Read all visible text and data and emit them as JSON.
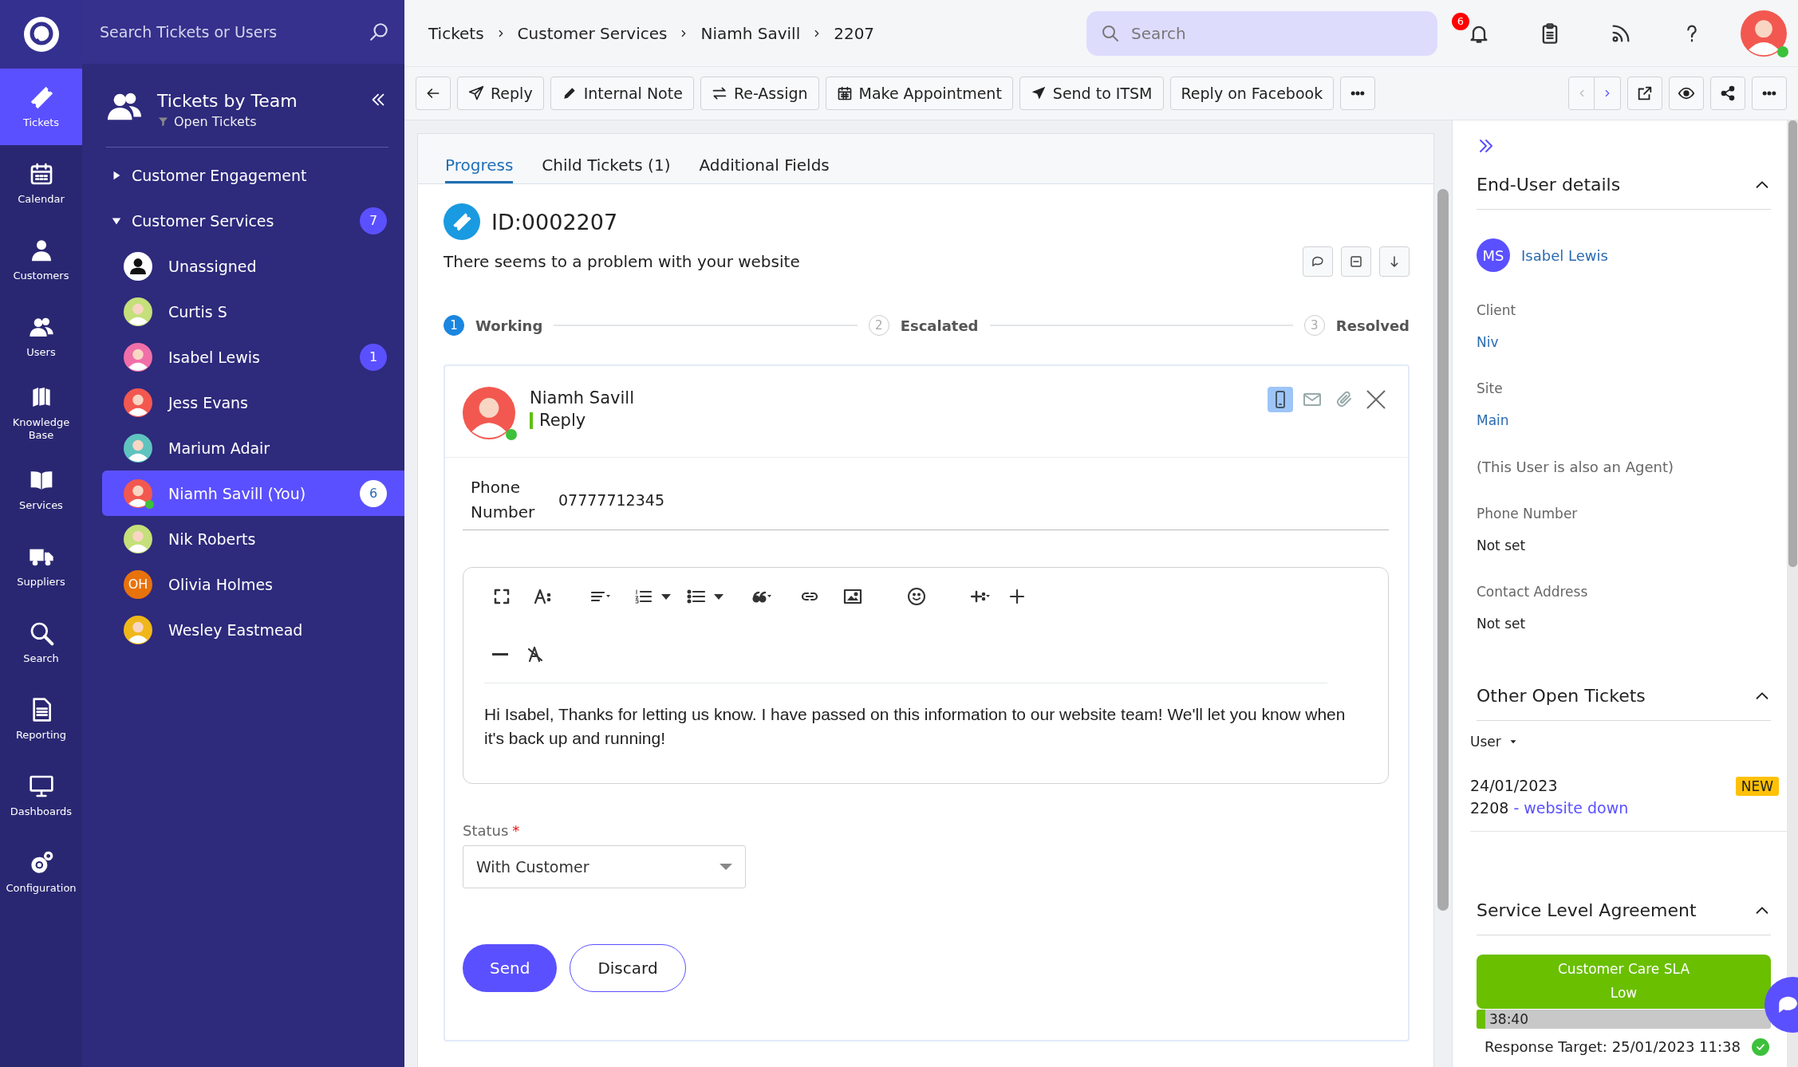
{
  "nav_rail": {
    "items": [
      {
        "label": "Tickets",
        "selected": true
      },
      {
        "label": "Calendar",
        "selected": false
      },
      {
        "label": "Customers",
        "selected": false
      },
      {
        "label": "Users",
        "selected": false
      },
      {
        "label": "Knowledge Base",
        "selected": false
      },
      {
        "label": "Services",
        "selected": false
      },
      {
        "label": "Suppliers",
        "selected": false
      },
      {
        "label": "Search",
        "selected": false
      },
      {
        "label": "Reporting",
        "selected": false
      },
      {
        "label": "Dashboards",
        "selected": false
      },
      {
        "label": "Configuration",
        "selected": false
      }
    ]
  },
  "team_panel": {
    "search": {
      "placeholder": "Search Tickets or Users"
    },
    "title": "Tickets by Team",
    "filter": "Open Tickets",
    "groups": [
      {
        "label": "Customer Engagement",
        "expanded": false
      },
      {
        "label": "Customer Services",
        "expanded": true,
        "count": "7",
        "children": [
          {
            "name": "Unassigned",
            "kind": "unassigned",
            "selected": false,
            "online": false
          },
          {
            "name": "Curtis S",
            "kind": "photo",
            "color": "#c5e07a",
            "selected": false,
            "online": false
          },
          {
            "name": "Isabel Lewis",
            "kind": "photo",
            "color": "#f06fa8",
            "count": "1",
            "selected": false,
            "online": false
          },
          {
            "name": "Jess Evans",
            "kind": "photo",
            "color": "#f2584f",
            "selected": false,
            "online": false
          },
          {
            "name": "Marium Adair",
            "kind": "photo",
            "color": "#5fc3c0",
            "selected": false,
            "online": false
          },
          {
            "name": "Niamh Savill (You)",
            "kind": "photo",
            "color": "#f2584f",
            "count": "6",
            "selected": true,
            "online": true
          },
          {
            "name": "Nik Roberts",
            "kind": "photo",
            "color": "#c5e07a",
            "selected": false,
            "online": false
          },
          {
            "name": "Olivia Holmes",
            "kind": "initials",
            "initials": "OH",
            "color": "#e8720c",
            "selected": false,
            "online": false
          },
          {
            "name": "Wesley Eastmead",
            "kind": "photo",
            "color": "#f0b71a",
            "selected": false,
            "online": false
          }
        ]
      }
    ]
  },
  "breadcrumb": [
    "Tickets",
    "Customer Services",
    "Niamh Savill",
    "2207"
  ],
  "top_bar": {
    "search": {
      "placeholder": "Search"
    },
    "notification_count": "6",
    "user_online": true
  },
  "actions": [
    "Reply",
    "Internal Note",
    "Re-Assign",
    "Make Appointment",
    "Send to ITSM",
    "Reply on Facebook"
  ],
  "tabs": [
    {
      "label": "Progress",
      "selected": true
    },
    {
      "label": "Child Tickets (1)",
      "selected": false
    },
    {
      "label": "Additional Fields",
      "selected": false
    }
  ],
  "ticket": {
    "id": "ID:0002207",
    "summary": "There seems to a problem with your website",
    "steps": [
      {
        "number": "1",
        "label": "Working",
        "selected": true
      },
      {
        "number": "2",
        "label": "Escalated",
        "selected": false
      },
      {
        "number": "3",
        "label": "Resolved",
        "selected": false
      }
    ],
    "reply": {
      "author": "Niamh Savill",
      "author_online": true,
      "type": "Reply",
      "channels": [
        {
          "selected": true
        },
        {
          "selected": false
        }
      ],
      "phone_label": "Phone Number",
      "phone_value": "07777712345",
      "body": "Hi Isabel, Thanks for letting us know. I have passed on this information to our website team! We'll let you know when it's back up and running!",
      "status": {
        "label": "Status",
        "required_mark": "*",
        "value": "With Customer"
      },
      "buttons": [
        {
          "label": "Send",
          "kind": "primary"
        },
        {
          "label": "Discard",
          "kind": "secondary"
        }
      ]
    }
  },
  "details_panel": {
    "end_user": {
      "title": "End-User details",
      "expanded": true,
      "initials": "MS",
      "name": "Isabel Lewis",
      "fields": [
        {
          "kind": "link",
          "label": "Client",
          "value": "Niv"
        },
        {
          "kind": "link",
          "label": "Site",
          "value": "Main"
        },
        {
          "kind": "note",
          "value": "(This User is also an Agent)"
        },
        {
          "kind": "plain",
          "label": "Phone Number",
          "value": "Not set"
        },
        {
          "kind": "plain",
          "label": "Contact Address",
          "value": "Not set"
        }
      ]
    },
    "other_tickets": {
      "title": "Other Open Tickets",
      "expanded": true,
      "filter": "User",
      "tickets": [
        {
          "date": "24/01/2023",
          "number": "2208",
          "separator": "-",
          "subject": "website down",
          "status": "NEW"
        }
      ]
    },
    "sla": {
      "title": "Service Level Agreement",
      "expanded": true,
      "name": "Customer Care SLA",
      "priority": "Low",
      "timer": "38:40",
      "level": 0.03,
      "target": "Response Target: 25/01/2023 11:38",
      "met": true
    }
  }
}
